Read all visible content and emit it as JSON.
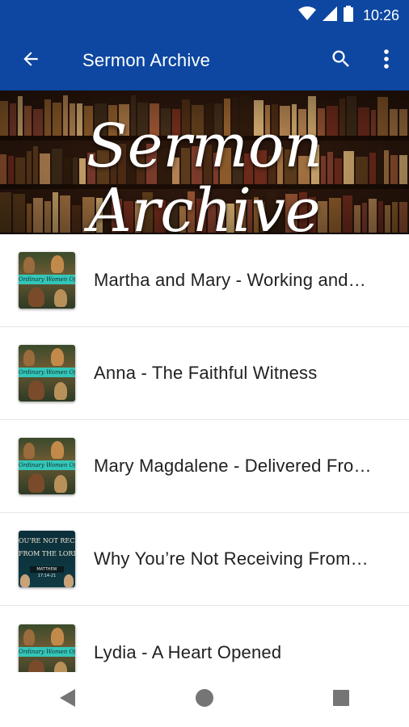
{
  "status_bar": {
    "time": "10:26"
  },
  "app_bar": {
    "title": "Sermon Archive",
    "back_icon": "back-arrow-icon",
    "search_icon": "search-icon",
    "more_icon": "more-vert-icon"
  },
  "banner": {
    "line1": "Sermon",
    "line2": "Archive"
  },
  "sermons": [
    {
      "title": "Martha and Mary - Working and…",
      "thumb": "series",
      "thumb_text": "Ordinary Women Of The"
    },
    {
      "title": "Anna - The Faithful Witness",
      "thumb": "series",
      "thumb_text": "Ordinary Women Of The"
    },
    {
      "title": "Mary Magdalene - Delivered Fro…",
      "thumb": "series",
      "thumb_text": "Ordinary Women Of The"
    },
    {
      "title": "Why You’re Not Receiving From…",
      "thumb": "alt",
      "thumb_line1": "OU'RE NOT RECE",
      "thumb_line2": "FROM THE LORD",
      "thumb_ref": "MATTHEW 17:14-21"
    },
    {
      "title": "Lydia - A Heart Opened",
      "thumb": "series",
      "thumb_text": "Ordinary Women Of The"
    }
  ],
  "colors": {
    "primary": "#0d47a1",
    "accent": "#2ed3c8",
    "text": "#212121"
  }
}
